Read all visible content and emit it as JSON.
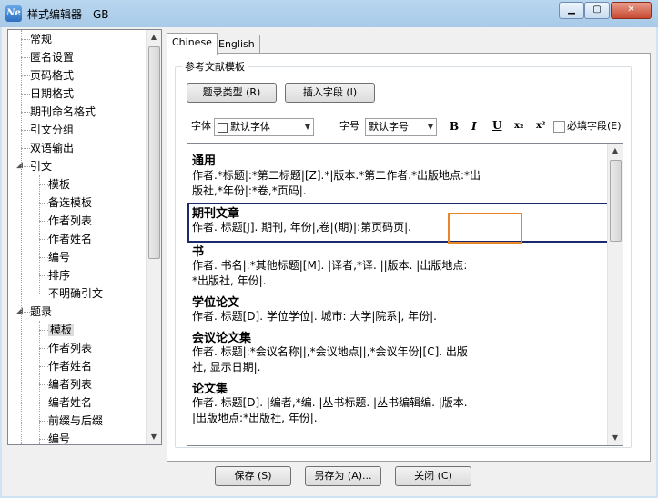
{
  "window": {
    "title": "样式编辑器 - GB",
    "app_icon": "Ne"
  },
  "tree": {
    "items": [
      {
        "label": "常规",
        "level": 0
      },
      {
        "label": "匿名设置",
        "level": 0
      },
      {
        "label": "页码格式",
        "level": 0
      },
      {
        "label": "日期格式",
        "level": 0
      },
      {
        "label": "期刊命名格式",
        "level": 0
      },
      {
        "label": "引文分组",
        "level": 0
      },
      {
        "label": "双语输出",
        "level": 0
      },
      {
        "label": "引文",
        "level": 0,
        "expander": "collapse-icon"
      },
      {
        "label": "模板",
        "level": 1
      },
      {
        "label": "备选模板",
        "level": 1
      },
      {
        "label": "作者列表",
        "level": 1
      },
      {
        "label": "作者姓名",
        "level": 1
      },
      {
        "label": "编号",
        "level": 1
      },
      {
        "label": "排序",
        "level": 1
      },
      {
        "label": "不明确引文",
        "level": 1
      },
      {
        "label": "题录",
        "level": 0,
        "expander": "collapse-icon"
      },
      {
        "label": "模板",
        "level": 1,
        "selected": true
      },
      {
        "label": "作者列表",
        "level": 1
      },
      {
        "label": "作者姓名",
        "level": 1
      },
      {
        "label": "编者列表",
        "level": 1
      },
      {
        "label": "编者姓名",
        "level": 1
      },
      {
        "label": "前缀与后缀",
        "level": 1
      },
      {
        "label": "编号",
        "level": 1
      }
    ]
  },
  "tabs": [
    {
      "label": "Chinese",
      "active": true
    },
    {
      "label": "English",
      "active": false
    }
  ],
  "group": {
    "caption": "参考文献模板",
    "ref_type_button": "题录类型 (R)",
    "insert_field_button": "插入字段 (I)",
    "font_label": "字体",
    "font_value": "默认字体",
    "size_label": "字号",
    "size_value": "默认字号",
    "bold": "B",
    "italic": "I",
    "underline": "U",
    "subscript": "x₂",
    "superscript": "x²",
    "required_field_label": "必填字段(E)"
  },
  "templates": [
    {
      "heading": "通用",
      "lines": [
        "作者.*标题|:*第二标题|[Z].*|版本.*第二作者.*出版地点:*出",
        "版社,*年份|:*卷,*页码|."
      ]
    },
    {
      "heading": "期刊文章",
      "lines": [
        "作者. 标题[J]. 期刊, 年份|,卷|(期)|:第页码页|."
      ]
    },
    {
      "heading": "书",
      "lines": [
        "作者. 书名|:*其他标题|[M]. |译者,*译. ||版本. |出版地点:",
        "*出版社, 年份|."
      ]
    },
    {
      "heading": "学位论文",
      "lines": [
        "作者. 标题[D]. 学位学位|. 城市: 大学|院系|, 年份|."
      ]
    },
    {
      "heading": "会议论文集",
      "lines": [
        "作者. 标题|:*会议名称||,*会议地点||,*会议年份|[C]. 出版",
        "社, 显示日期|."
      ]
    },
    {
      "heading": "论文集",
      "lines": [
        "作者. 标题[D]. |编者,*编. |丛书标题. |丛书编辑编. |版本.",
        "|出版地点:*出版社, 年份|."
      ]
    }
  ],
  "highlight_text": "第页码页",
  "footer": {
    "save": "保存 (S)",
    "save_as": "另存为 (A)...",
    "close": "关闭 (C)"
  }
}
